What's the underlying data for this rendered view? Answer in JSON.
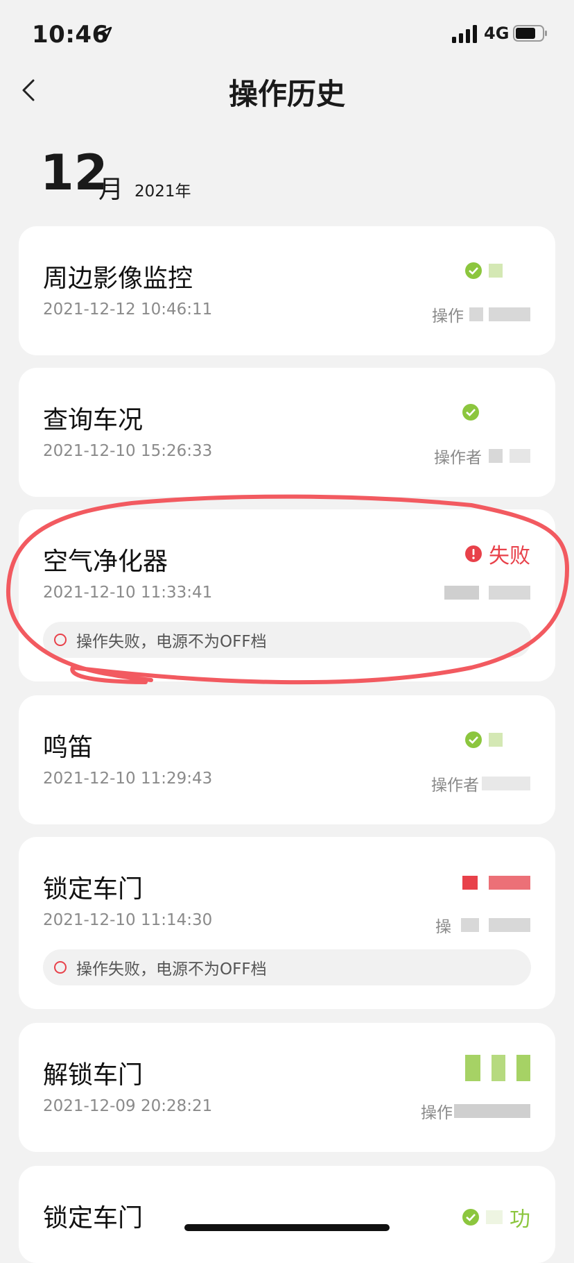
{
  "status_bar": {
    "time": "10:46",
    "network": "4G"
  },
  "nav": {
    "title": "操作历史"
  },
  "month_header": {
    "month": "12",
    "month_unit": "月",
    "year": "2021年"
  },
  "records": [
    {
      "title": "周边影像监控",
      "time": "2021-12-12 10:46:11",
      "status": "success",
      "operator": "操作"
    },
    {
      "title": "查询车况",
      "time": "2021-12-10 15:26:33",
      "status": "success",
      "operator": "操作者"
    },
    {
      "title": "空气净化器",
      "time": "2021-12-10 11:33:41",
      "status": "fail",
      "status_label": "失败",
      "message": "操作失败，电源不为OFF档"
    },
    {
      "title": "鸣笛",
      "time": "2021-12-10 11:29:43",
      "status": "success",
      "operator": "操作者"
    },
    {
      "title": "锁定车门",
      "time": "2021-12-10 11:14:30",
      "status": "fail",
      "operator": "操",
      "message": "操作失败，电源不为OFF档"
    },
    {
      "title": "解锁车门",
      "time": "2021-12-09 20:28:21",
      "status": "success",
      "operator": "操作"
    },
    {
      "title": "锁定车门",
      "time": "",
      "status": "success",
      "status_label": "功"
    }
  ],
  "colors": {
    "success": "#8cc63e",
    "fail": "#e8414a",
    "annotation": "#f25a60"
  }
}
